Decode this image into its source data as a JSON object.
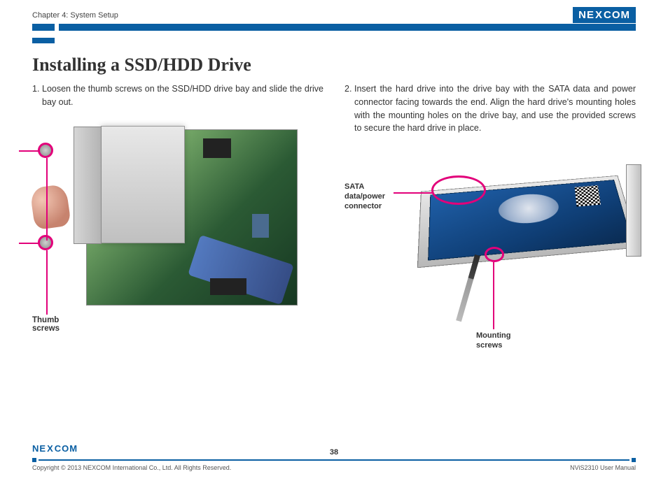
{
  "header": {
    "chapter": "Chapter 4: System Setup",
    "logo_text_1": "NE",
    "logo_text_x": "X",
    "logo_text_2": "COM"
  },
  "title": "Installing a SSD/HDD Drive",
  "steps": {
    "s1_num": "1.",
    "s1_text": "Loosen the thumb screws on the SSD/HDD drive bay and slide the drive bay out.",
    "s2_num": "2.",
    "s2_text": "Insert the hard drive into the drive bay with the SATA data and power connector facing towards the end. Align the hard drive's mounting holes with the mounting holes on the drive bay, and use the provided screws to secure the hard drive in place."
  },
  "labels": {
    "thumb_screws": "Thumb\nscrews",
    "sata": "SATA\ndata/power\nconnector",
    "mounting": "Mounting\nscrews"
  },
  "footer": {
    "copyright": "Copyright © 2013 NEXCOM International Co., Ltd. All Rights Reserved.",
    "page": "38",
    "doc": "NViS2310 User Manual",
    "logo_text_1": "NE",
    "logo_text_x": "X",
    "logo_text_2": "COM"
  }
}
